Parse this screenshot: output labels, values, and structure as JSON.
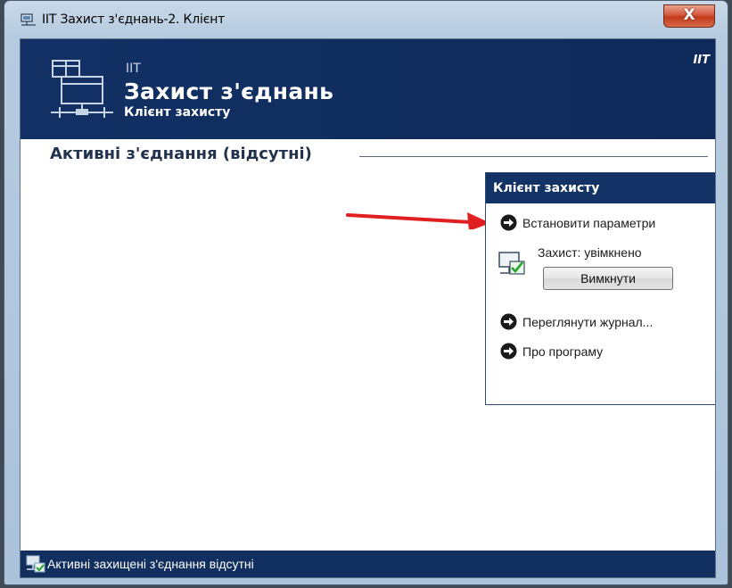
{
  "window": {
    "title": "ІІТ Захист з'єднань-2. Клієнт",
    "close_label": "X"
  },
  "header": {
    "brand_small": "ІІТ",
    "brand_title": "Захист з'єднань",
    "brand_subtitle": "Клієнт захисту",
    "brand_corner": "ІІТ",
    "logo_icon": "network-computers-icon"
  },
  "main": {
    "section_title": "Активні з'єднання (відсутні)"
  },
  "panel": {
    "title": "Клієнт захисту",
    "tasks": [
      {
        "label": "Встановити параметри",
        "icon": "arrow-circle-icon"
      },
      {
        "label": "Переглянути журнал...",
        "icon": "arrow-circle-icon"
      },
      {
        "label": "Про програму",
        "icon": "arrow-circle-icon"
      }
    ],
    "protection_status": "Захист: увімкнено",
    "toggle_button": "Вимкнути",
    "status_icon": "monitor-check-icon"
  },
  "statusbar": {
    "text": "Активні захищені з'єднання відсутні",
    "icon": "network-status-icon"
  },
  "annotation": {
    "icon": "red-arrow-icon",
    "color": "#e02020"
  },
  "colors": {
    "header_bg": "#0f2d5e",
    "panel_header_bg": "#133366",
    "statusbar_bg": "#12305f"
  }
}
